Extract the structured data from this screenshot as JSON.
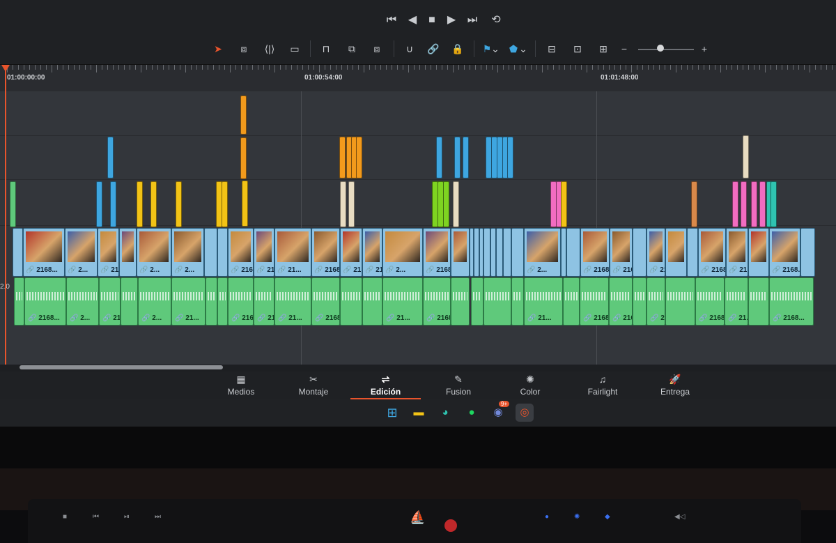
{
  "timeline": {
    "timecodes": [
      "01:00:00:00",
      "01:00:54:00",
      "01:01:48:00"
    ],
    "track_label": "2.0",
    "video_clip_labels": [
      "2168...",
      "2...",
      "21...",
      "2...",
      "2...",
      "21...",
      "216...",
      "21...",
      "21...",
      "2168...",
      "21...",
      "21...",
      "2...",
      "2168...",
      "2...",
      "21689...",
      "216...",
      "21...",
      "2168...",
      "21...",
      "2168..."
    ],
    "audio_clip_labels": [
      "2168...",
      "2...",
      "216...",
      "2...",
      "21...",
      "216...",
      "21...",
      "21...",
      "2168...",
      "21...",
      "21...",
      "2168...",
      "21689...",
      "216...",
      "21...",
      "2168...",
      "21...",
      "2168..."
    ]
  },
  "pages": [
    {
      "label": "Medios",
      "icon": "media-icon"
    },
    {
      "label": "Montaje",
      "icon": "cut-icon"
    },
    {
      "label": "Edición",
      "icon": "edit-icon"
    },
    {
      "label": "Fusion",
      "icon": "fusion-icon"
    },
    {
      "label": "Color",
      "icon": "color-icon"
    },
    {
      "label": "Fairlight",
      "icon": "fairlight-icon"
    },
    {
      "label": "Entrega",
      "icon": "deliver-icon"
    }
  ],
  "taskbar": {
    "discord_badge": "9+"
  },
  "colors": {
    "orange": "#f29a1c",
    "yellow": "#f2c316",
    "blue": "#3ea6e0",
    "green": "#7ed321",
    "pink": "#f26cc1",
    "cream": "#e8dcc2",
    "brown": "#d9894a",
    "teal": "#2fc3b0",
    "accent": "#e8542c"
  }
}
